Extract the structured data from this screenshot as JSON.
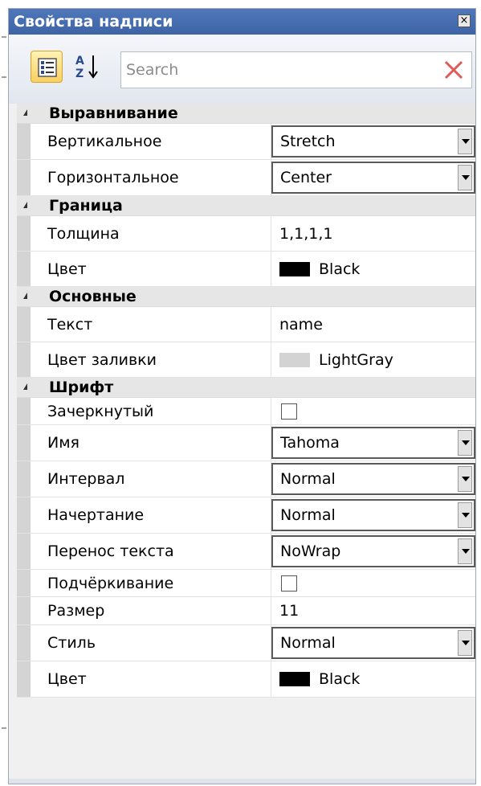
{
  "window": {
    "title": "Свойства надписи",
    "close_glyph": "×"
  },
  "toolbar": {
    "search_placeholder": "Search",
    "sort_az_label_a": "A",
    "sort_az_label_z": "Z"
  },
  "colors": {
    "black": "#000000",
    "lightgray": "#d3d3d3"
  },
  "categories": [
    {
      "name": "Выравнивание",
      "rows": [
        {
          "label": "Вертикальное",
          "value": "Stretch",
          "kind": "dropdown"
        },
        {
          "label": "Горизонтальное",
          "value": "Center",
          "kind": "dropdown"
        }
      ]
    },
    {
      "name": "Граница",
      "rows": [
        {
          "label": "Толщина",
          "value": "1,1,1,1",
          "kind": "text"
        },
        {
          "label": "Цвет",
          "value": "Black",
          "kind": "color"
        }
      ]
    },
    {
      "name": "Основные",
      "rows": [
        {
          "label": "Текст",
          "value": "name",
          "kind": "text"
        },
        {
          "label": "Цвет заливки",
          "value": "LightGray",
          "kind": "color"
        }
      ]
    },
    {
      "name": "Шрифт",
      "rows": [
        {
          "label": "Зачеркнутый",
          "value": "",
          "kind": "checkbox"
        },
        {
          "label": "Имя",
          "value": "Tahoma",
          "kind": "dropdown"
        },
        {
          "label": "Интервал",
          "value": "Normal",
          "kind": "dropdown"
        },
        {
          "label": "Начертание",
          "value": "Normal",
          "kind": "dropdown"
        },
        {
          "label": "Перенос текста",
          "value": "NoWrap",
          "kind": "dropdown"
        },
        {
          "label": "Подчёркивание",
          "value": "",
          "kind": "checkbox"
        },
        {
          "label": "Размер",
          "value": "11",
          "kind": "text"
        },
        {
          "label": "Стиль",
          "value": "Normal",
          "kind": "dropdown"
        },
        {
          "label": "Цвет",
          "value": "Black",
          "kind": "color"
        }
      ]
    }
  ]
}
